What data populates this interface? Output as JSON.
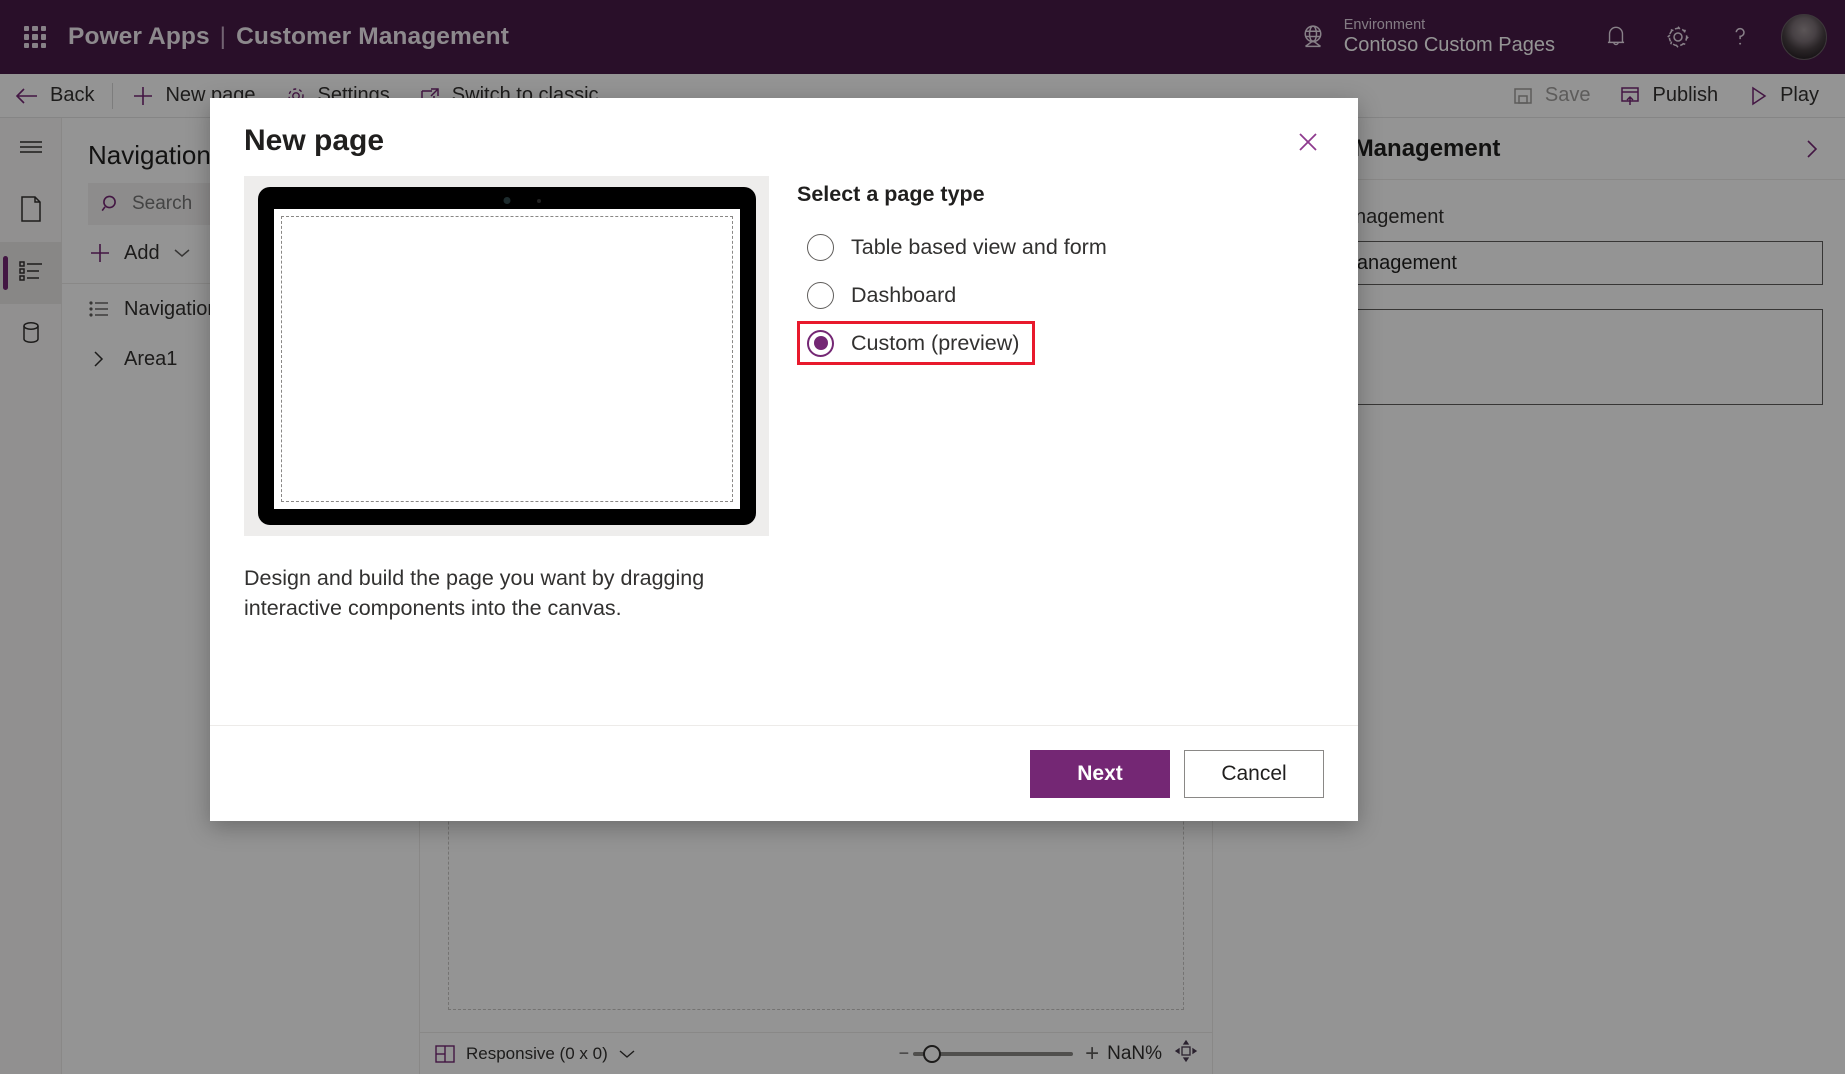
{
  "header": {
    "waffle_icon": "app-launcher-icon",
    "product": "Power Apps",
    "separator": "|",
    "app_name": "Customer Management",
    "globe_icon": "globe-icon",
    "environment_label": "Environment",
    "environment_value": "Contoso Custom Pages",
    "notifications_icon": "bell-icon",
    "settings_icon": "gear-icon",
    "help_icon": "question-mark-icon",
    "avatar": "user-avatar",
    "bg_color": "#471B47"
  },
  "command_bar": {
    "back": "Back",
    "new_page": "New page",
    "settings": "Settings",
    "switch_to_classic": "Switch to classic",
    "save": "Save",
    "publish": "Publish",
    "play": "Play"
  },
  "left_rail": {
    "items": [
      {
        "name": "menu-icon",
        "label": "Menu",
        "active": false
      },
      {
        "name": "pages-icon",
        "label": "Pages",
        "active": false
      },
      {
        "name": "navigation-icon",
        "label": "Navigation",
        "active": true
      },
      {
        "name": "data-icon",
        "label": "Data",
        "active": false
      }
    ]
  },
  "nav_panel": {
    "title": "Navigation",
    "search_placeholder": "Search",
    "search_value": "",
    "add_label": "Add",
    "tree": [
      {
        "label": "Navigation",
        "icon": "list-icon"
      },
      {
        "label": "Area1",
        "icon": "chevron-right-icon"
      }
    ]
  },
  "right_panel": {
    "title": "Customer Management",
    "chevron_icon": "chevron-right-icon",
    "field_label": "Customer Management",
    "field_value": "Customer Management",
    "textarea_value": ""
  },
  "status_bar": {
    "device_icon": "responsive-layout-icon",
    "device_label": "Responsive (0 x 0)",
    "chevron_icon": "chevron-down-icon",
    "zoom_minus": "−",
    "zoom_plus": "+",
    "zoom_value": "NaN%",
    "fit_icon": "fit-to-screen-icon"
  },
  "dialog": {
    "title": "New page",
    "close_icon": "close-icon",
    "preview_image": "tablet-device-mockup",
    "description": "Design and build the page you want by dragging interactive components into the canvas.",
    "select_label": "Select a page type",
    "options": [
      {
        "label": "Table based view and form",
        "checked": false,
        "highlighted": false
      },
      {
        "label": "Dashboard",
        "checked": false,
        "highlighted": false
      },
      {
        "label": "Custom (preview)",
        "checked": true,
        "highlighted": true
      }
    ],
    "highlight_color": "#e8192c",
    "accent_color": "#742774",
    "primary_button": "Next",
    "secondary_button": "Cancel"
  }
}
